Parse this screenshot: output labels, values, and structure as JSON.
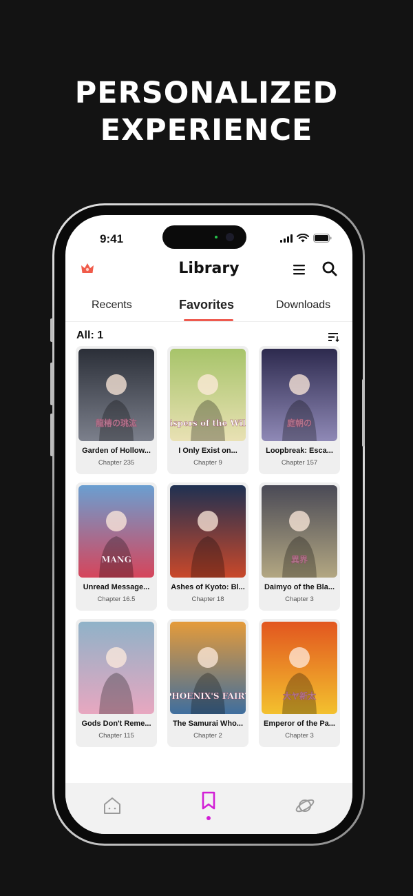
{
  "headline": {
    "line1": "PERSONALIZED",
    "line2": "EXPERIENCE"
  },
  "status_bar": {
    "time": "9:41"
  },
  "app": {
    "title": "Library",
    "accent": "#ee5a4f",
    "nav_active_color": "#d21fd6"
  },
  "tabs": [
    {
      "label": "Recents",
      "active": false
    },
    {
      "label": "Favorites",
      "active": true
    },
    {
      "label": "Downloads",
      "active": false
    }
  ],
  "list_header": {
    "count_label": "All: 1"
  },
  "items": [
    {
      "title": "Garden of Hollow...",
      "chapter": "Chapter 235",
      "cover_text": "龍椿の珧汯",
      "cover_colors": [
        "#2b2f38",
        "#7c808c"
      ]
    },
    {
      "title": "I Only Exist on...",
      "chapter": "Chapter 9",
      "cover_text": "Whispers of the Willow",
      "cover_colors": [
        "#a7c46a",
        "#e9e1b4"
      ]
    },
    {
      "title": "Loopbreak: Esca...",
      "chapter": "Chapter 157",
      "cover_text": "庭朝の",
      "cover_colors": [
        "#2d2a4e",
        "#8f89b6"
      ]
    },
    {
      "title": "Unread Message...",
      "chapter": "Chapter 16.5",
      "cover_text": "MANG",
      "cover_colors": [
        "#6a9fd1",
        "#d6455b"
      ]
    },
    {
      "title": "Ashes of Kyoto: Bl...",
      "chapter": "Chapter 18",
      "cover_text": "",
      "cover_colors": [
        "#1f3152",
        "#c9482a"
      ]
    },
    {
      "title": "Daimyo of the Bla...",
      "chapter": "Chapter 3",
      "cover_text": "異界",
      "cover_colors": [
        "#4a4a56",
        "#b3a782"
      ]
    },
    {
      "title": "Gods Don't Reme...",
      "chapter": "Chapter 115",
      "cover_text": "",
      "cover_colors": [
        "#8fb2c8",
        "#e8a7c0"
      ]
    },
    {
      "title": "The Samurai Who...",
      "chapter": "Chapter 2",
      "cover_text": "PHOENIX'S FAIRY",
      "cover_colors": [
        "#e59b3a",
        "#3f6e9e"
      ]
    },
    {
      "title": "Emperor of the Pa...",
      "chapter": "Chapter 3",
      "cover_text": "大ヤ新太",
      "cover_colors": [
        "#e2561f",
        "#f3c12e"
      ]
    }
  ],
  "bottom_nav": [
    {
      "name": "home",
      "active": false
    },
    {
      "name": "library",
      "active": true
    },
    {
      "name": "explore",
      "active": false
    }
  ]
}
